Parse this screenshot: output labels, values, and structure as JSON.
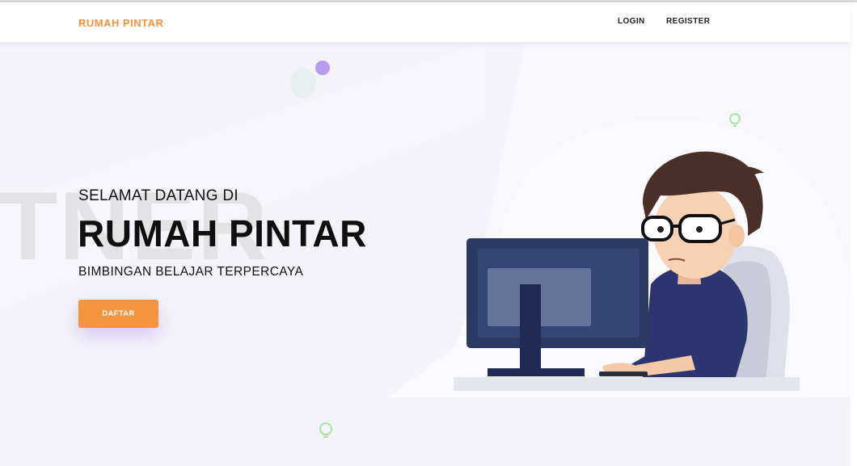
{
  "navbar": {
    "brand": "RUMAH PINTAR",
    "links": [
      {
        "label": "LOGIN"
      },
      {
        "label": "REGISTER"
      }
    ]
  },
  "hero": {
    "background_text": "TNER",
    "welcome": "SELAMAT DATANG DI",
    "title": "RUMAH PINTAR",
    "tagline": "BIMBINGAN BELAJAR TERPERCAYA",
    "cta_label": "DAFTAR"
  },
  "icons": {
    "illustration": "student-at-computer-illustration",
    "decorations": [
      "lightbulb-icon",
      "circle-decoration"
    ]
  },
  "colors": {
    "brand": "#f4903a",
    "cta": "#f7953f",
    "hero_background": "#f4f3fa",
    "accent_purple": "#b79af2",
    "accent_green": "#a8e6a0"
  }
}
